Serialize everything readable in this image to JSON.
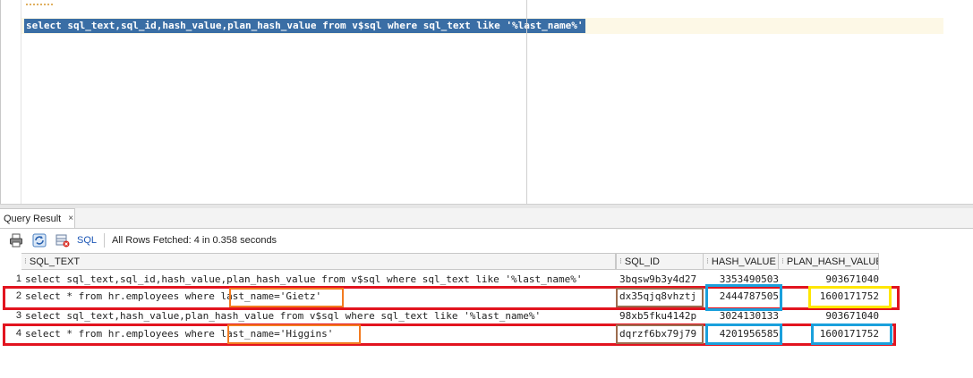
{
  "editor": {
    "query": "select sql_text,sql_id,hash_value,plan_hash_value from v$sql where sql_text like '%last_name%'"
  },
  "results_tab": {
    "label": "Query Result",
    "close": "×"
  },
  "toolbar": {
    "sql_label": "SQL",
    "status": "All Rows Fetched: 4 in 0.358 seconds"
  },
  "grid": {
    "columns": [
      "SQL_TEXT",
      "SQL_ID",
      "HASH_VALUE",
      "PLAN_HASH_VALUE"
    ],
    "rows": [
      {
        "num": "1",
        "sql_text": "select sql_text,sql_id,hash_value,plan_hash_value from v$sql where sql_text like '%last_name%'",
        "sql_id": "3bqsw9b3y4d27",
        "hash_value": "3353490503",
        "plan_hash_value": "903671040"
      },
      {
        "num": "2",
        "sql_text": "select * from hr.employees where last_name='Gietz'",
        "sql_id": "dx35qjq8vhztj",
        "hash_value": "2444787505",
        "plan_hash_value": "1600171752"
      },
      {
        "num": "3",
        "sql_text": "select sql_text,hash_value,plan_hash_value from v$sql where sql_text like '%last_name%'",
        "sql_id": "98xb5fku4142p",
        "hash_value": "3024130133",
        "plan_hash_value": "903671040"
      },
      {
        "num": "4",
        "sql_text": "select * from hr.employees where last_name='Higgins'",
        "sql_id": "dqrzf6bx79j79",
        "hash_value": "4201956585",
        "plan_hash_value": "1600171752"
      }
    ]
  },
  "annotation_colors": {
    "row": "#e2141f",
    "predicate": "#f37b20",
    "sql_id": "#9c6c4e",
    "hash": "#1aa0dc",
    "plan_same": "#ffe600"
  }
}
